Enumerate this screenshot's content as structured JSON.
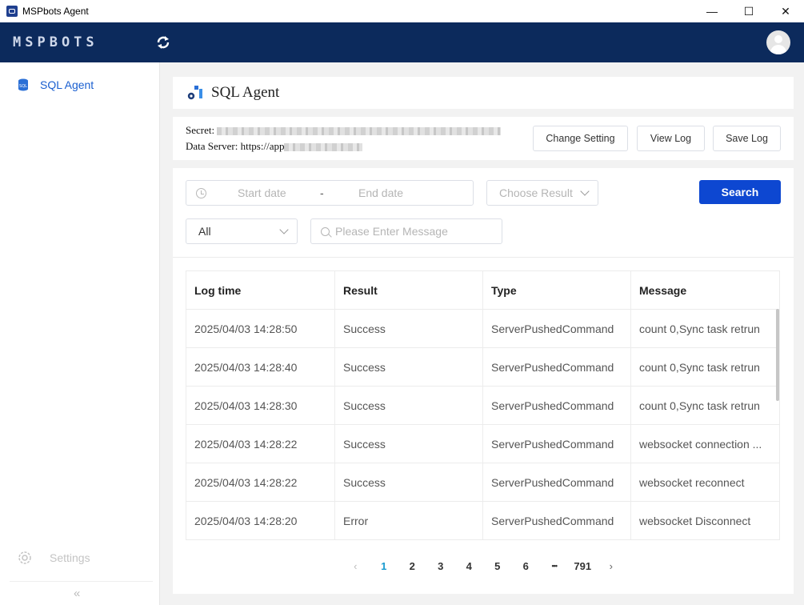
{
  "window": {
    "title": "MSPbots Agent",
    "minimize": "—",
    "maximize": "☐",
    "close": "✕"
  },
  "header": {
    "logo": "MSPBOTS"
  },
  "sidebar": {
    "items": [
      {
        "label": "SQL Agent"
      }
    ],
    "settings_label": "Settings",
    "collapse": "«"
  },
  "page": {
    "title": "SQL Agent"
  },
  "info": {
    "secret_label": "Secret:",
    "server_label": "Data Server: https://app"
  },
  "toolbar": {
    "change_setting": "Change Setting",
    "view_log": "View Log",
    "save_log": "Save Log"
  },
  "filters": {
    "start_placeholder": "Start date",
    "separator": "-",
    "end_placeholder": "End date",
    "result_placeholder": "Choose Result",
    "type_value": "All",
    "message_placeholder": "Please Enter Message",
    "search_label": "Search"
  },
  "table": {
    "columns": [
      "Log time",
      "Result",
      "Type",
      "Message"
    ],
    "rows": [
      [
        "2025/04/03 14:28:50",
        "Success",
        "ServerPushedCommand",
        "count 0,Sync task retrun"
      ],
      [
        "2025/04/03 14:28:40",
        "Success",
        "ServerPushedCommand",
        "count 0,Sync task retrun"
      ],
      [
        "2025/04/03 14:28:30",
        "Success",
        "ServerPushedCommand",
        "count 0,Sync task retrun"
      ],
      [
        "2025/04/03 14:28:22",
        "Success",
        "ServerPushedCommand",
        "websocket connection ..."
      ],
      [
        "2025/04/03 14:28:22",
        "Success",
        "ServerPushedCommand",
        "websocket reconnect"
      ],
      [
        "2025/04/03 14:28:20",
        "Error",
        "ServerPushedCommand",
        "websocket Disconnect"
      ]
    ]
  },
  "pagination": {
    "prev": "‹",
    "pages": [
      "1",
      "2",
      "3",
      "4",
      "5",
      "6"
    ],
    "ellipsis": "•••",
    "last": "791",
    "next": "›",
    "current": "1"
  },
  "colors": {
    "header_bg": "#0c2a5c",
    "accent": "#1a5fd0",
    "primary_button": "#0d47d1",
    "active_page": "#1a9bd0"
  }
}
